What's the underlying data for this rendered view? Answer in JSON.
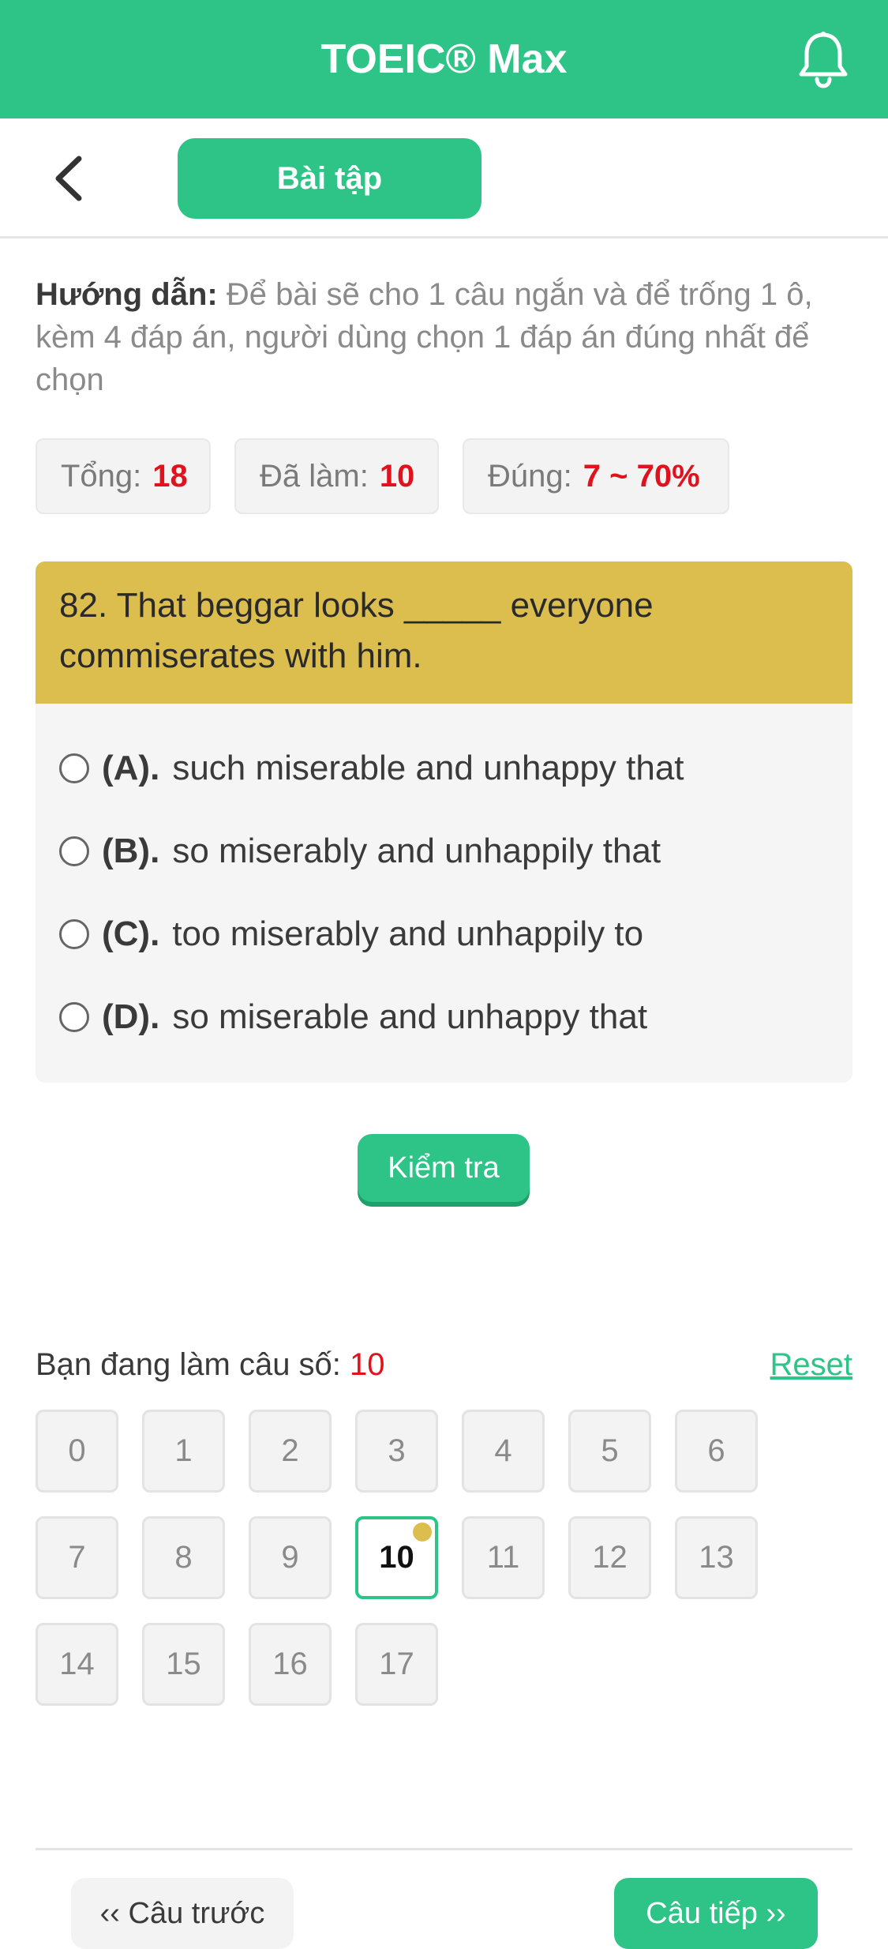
{
  "app": {
    "title": "TOEIC® Max",
    "accent_color": "#2ec487",
    "icons": {
      "notification": "bell-icon",
      "back": "chevron-left-icon"
    }
  },
  "subbar": {
    "tab_label": "Bài tập"
  },
  "guide": {
    "label": "Hướng dẫn:",
    "text": " Để bài sẽ cho 1 câu ngắn và để trống 1 ô, kèm 4 đáp án, người dùng chọn 1 đáp án đúng nhất để chọn"
  },
  "stats": {
    "total_label": "Tổng:",
    "total_value": "18",
    "done_label": "Đã làm:",
    "done_value": "10",
    "correct_label": "Đúng:",
    "correct_value": "7 ~ 70%"
  },
  "question": {
    "text": "82. That beggar looks _____ everyone commiserates with him.",
    "header_color": "#dcbe4f",
    "options": [
      {
        "label": "(A).",
        "text": "such miserable and unhappy that"
      },
      {
        "label": "(B).",
        "text": "so miserably and unhappily that"
      },
      {
        "label": "(C).",
        "text": "too miserably and unhappily to"
      },
      {
        "label": "(D).",
        "text": "so miserable and unhappy that"
      }
    ]
  },
  "check_button": "Kiểm tra",
  "progress": {
    "label": "Bạn đang làm câu số:",
    "current": "10",
    "reset": "Reset"
  },
  "grid": {
    "numbers": [
      "0",
      "1",
      "2",
      "3",
      "4",
      "5",
      "6",
      "7",
      "8",
      "9",
      "10",
      "11",
      "12",
      "13",
      "14",
      "15",
      "16",
      "17"
    ]
  },
  "nav": {
    "prev": "‹‹ Câu trước",
    "next": "Câu tiếp ››"
  }
}
